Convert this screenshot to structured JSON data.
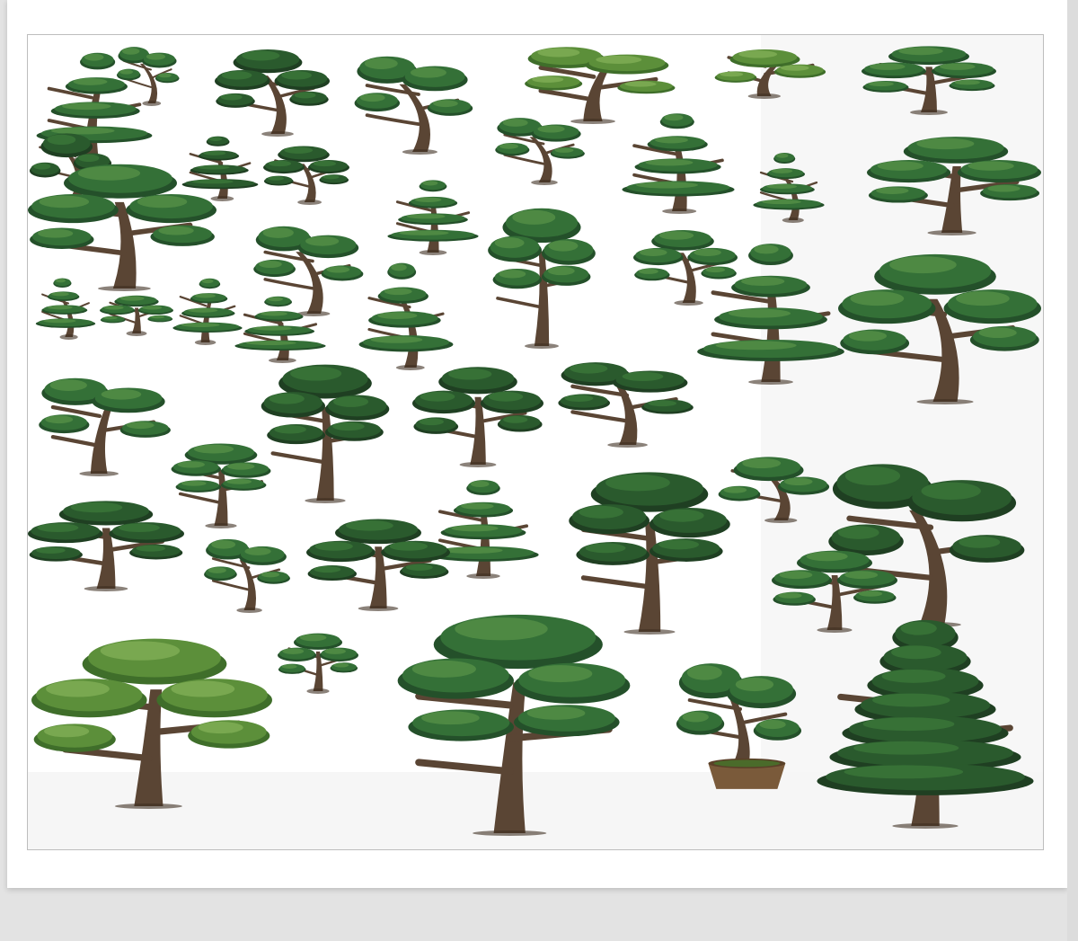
{
  "image": {
    "subject": "",
    "colors": {
      "background": "#e3e3e3",
      "sheet": "#ffffff",
      "frame_border": "#bdbdbd",
      "foliage_dark": "#1f4a24",
      "foliage_mid": "#2f6b33",
      "foliage_light": "#5f9a3f",
      "trunk": "#5a4534",
      "pot": "#7a5a3a"
    }
  }
}
